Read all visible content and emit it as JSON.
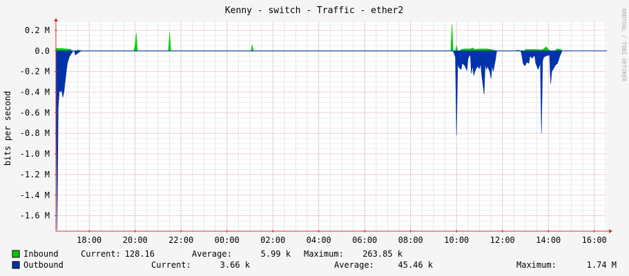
{
  "chart_data": {
    "type": "area",
    "title": "Kenny - switch - Traffic - ether2",
    "ylabel": "bits per second",
    "watermark": "RRDTOOL / TOBI OETIKER",
    "ylim": [
      -1.75,
      0.28
    ],
    "y_ticks": [
      {
        "value": 0.2,
        "label": "0.2 M"
      },
      {
        "value": 0.0,
        "label": "0.0"
      },
      {
        "value": -0.2,
        "label": "-0.2 M"
      },
      {
        "value": -0.4,
        "label": "-0.4 M"
      },
      {
        "value": -0.6,
        "label": "-0.6 M"
      },
      {
        "value": -0.8,
        "label": "-0.8 M"
      },
      {
        "value": -1.0,
        "label": "-1.0 M"
      },
      {
        "value": -1.2,
        "label": "-1.2 M"
      },
      {
        "value": -1.4,
        "label": "-1.4 M"
      },
      {
        "value": -1.6,
        "label": "-1.6 M"
      }
    ],
    "xlim": [
      16.55,
      16.55
    ],
    "x_ticks": [
      {
        "value": 18,
        "label": "18:00"
      },
      {
        "value": 20,
        "label": "20:00"
      },
      {
        "value": 22,
        "label": "22:00"
      },
      {
        "value": 24,
        "label": "00:00"
      },
      {
        "value": 26,
        "label": "02:00"
      },
      {
        "value": 28,
        "label": "04:00"
      },
      {
        "value": 30,
        "label": "06:00"
      },
      {
        "value": 32,
        "label": "08:00"
      },
      {
        "value": 34,
        "label": "10:00"
      },
      {
        "value": 36,
        "label": "12:00"
      },
      {
        "value": 38,
        "label": "14:00"
      },
      {
        "value": 40,
        "label": "16:00"
      }
    ],
    "grid": true,
    "series": [
      {
        "name": "Inbound",
        "color": "#00cc00",
        "points": [
          [
            16.57,
            0.025
          ],
          [
            16.9,
            0.022
          ],
          [
            17.2,
            0.015
          ],
          [
            17.25,
            0.0
          ],
          [
            17.45,
            0.0
          ],
          [
            17.5,
            0.01
          ],
          [
            17.7,
            0.0
          ],
          [
            19.95,
            0.0
          ],
          [
            20.0,
            0.06
          ],
          [
            20.05,
            0.17
          ],
          [
            20.1,
            0.0
          ],
          [
            21.45,
            0.0
          ],
          [
            21.5,
            0.18
          ],
          [
            21.55,
            0.0
          ],
          [
            25.05,
            0.0
          ],
          [
            25.1,
            0.06
          ],
          [
            25.15,
            0.0
          ],
          [
            33.75,
            0.0
          ],
          [
            33.8,
            0.26
          ],
          [
            33.85,
            0.0
          ],
          [
            33.95,
            0.0
          ],
          [
            34.0,
            0.05
          ],
          [
            34.05,
            0.0
          ],
          [
            34.15,
            0.0
          ],
          [
            34.2,
            0.015
          ],
          [
            34.35,
            0.02
          ],
          [
            34.6,
            0.02
          ],
          [
            34.7,
            0.03
          ],
          [
            34.8,
            0.015
          ],
          [
            35.0,
            0.02
          ],
          [
            35.3,
            0.02
          ],
          [
            35.5,
            0.015
          ],
          [
            35.75,
            0.0
          ],
          [
            36.6,
            0.0
          ],
          [
            36.65,
            0.01
          ],
          [
            36.85,
            0.0
          ],
          [
            36.95,
            0.0
          ],
          [
            37.0,
            0.015
          ],
          [
            37.5,
            0.015
          ],
          [
            37.7,
            0.01
          ],
          [
            37.8,
            0.02
          ],
          [
            37.9,
            0.04
          ],
          [
            38.0,
            0.015
          ],
          [
            38.1,
            0.0
          ],
          [
            38.3,
            0.0
          ],
          [
            38.35,
            0.02
          ],
          [
            38.55,
            0.015
          ],
          [
            38.6,
            0.0
          ]
        ]
      },
      {
        "name": "Outbound",
        "color": "#0033aa",
        "points": [
          [
            16.55,
            0.0
          ],
          [
            16.6,
            -1.74
          ],
          [
            16.65,
            -0.55
          ],
          [
            16.7,
            -0.38
          ],
          [
            16.75,
            -0.4
          ],
          [
            16.8,
            -0.38
          ],
          [
            16.85,
            -0.45
          ],
          [
            16.9,
            -0.4
          ],
          [
            16.95,
            -0.3
          ],
          [
            17.0,
            -0.2
          ],
          [
            17.05,
            -0.12
          ],
          [
            17.1,
            -0.08
          ],
          [
            17.15,
            -0.05
          ],
          [
            17.3,
            0.0
          ],
          [
            17.35,
            0.0
          ],
          [
            17.4,
            -0.04
          ],
          [
            17.5,
            -0.02
          ],
          [
            17.65,
            0.0
          ],
          [
            33.85,
            0.0
          ],
          [
            33.9,
            -0.03
          ],
          [
            33.95,
            -0.06
          ],
          [
            34.0,
            -0.82
          ],
          [
            34.05,
            -0.12
          ],
          [
            34.1,
            -0.16
          ],
          [
            34.2,
            -0.18
          ],
          [
            34.25,
            -0.12
          ],
          [
            34.35,
            -0.14
          ],
          [
            34.45,
            -0.19
          ],
          [
            34.5,
            -0.08
          ],
          [
            34.55,
            -0.05
          ],
          [
            34.6,
            -0.04
          ],
          [
            34.65,
            -0.22
          ],
          [
            34.7,
            -0.14
          ],
          [
            34.75,
            -0.24
          ],
          [
            34.8,
            -0.2
          ],
          [
            34.9,
            -0.15
          ],
          [
            35.0,
            -0.17
          ],
          [
            35.05,
            -0.12
          ],
          [
            35.1,
            -0.24
          ],
          [
            35.2,
            -0.42
          ],
          [
            35.25,
            -0.12
          ],
          [
            35.3,
            -0.18
          ],
          [
            35.35,
            -0.15
          ],
          [
            35.45,
            -0.2
          ],
          [
            35.5,
            -0.27
          ],
          [
            35.55,
            -0.14
          ],
          [
            35.6,
            -0.2
          ],
          [
            35.7,
            -0.08
          ],
          [
            35.75,
            0.0
          ],
          [
            36.8,
            0.0
          ],
          [
            36.85,
            -0.05
          ],
          [
            36.9,
            -0.12
          ],
          [
            36.95,
            -0.14
          ],
          [
            37.0,
            -0.14
          ],
          [
            37.05,
            -0.11
          ],
          [
            37.15,
            -0.12
          ],
          [
            37.2,
            -0.05
          ],
          [
            37.3,
            -0.07
          ],
          [
            37.4,
            -0.04
          ],
          [
            37.45,
            -0.12
          ],
          [
            37.55,
            -0.18
          ],
          [
            37.65,
            -0.12
          ],
          [
            37.7,
            -0.8
          ],
          [
            37.75,
            -0.1
          ],
          [
            37.8,
            -0.06
          ],
          [
            37.9,
            -0.05
          ],
          [
            38.0,
            -0.04
          ],
          [
            38.05,
            -0.04
          ],
          [
            38.1,
            -0.32
          ],
          [
            38.15,
            -0.2
          ],
          [
            38.2,
            -0.18
          ],
          [
            38.3,
            -0.14
          ],
          [
            38.4,
            -0.12
          ],
          [
            38.5,
            -0.05
          ],
          [
            38.6,
            0.0
          ]
        ]
      }
    ],
    "legend": [
      {
        "name": "Inbound",
        "color": "#00cc00",
        "current_label": "Current:",
        "current": "128.16",
        "average_label": "Average:",
        "average": "5.99 k",
        "maximum_label": "Maximum:",
        "maximum": "263.85 k"
      },
      {
        "name": "Outbound",
        "color": "#0033aa",
        "current_label": "Current:",
        "current": "3.66 k",
        "average_label": "Average:",
        "average": "45.46 k",
        "maximum_label": "Maximum:",
        "maximum": "1.74 M"
      }
    ]
  }
}
